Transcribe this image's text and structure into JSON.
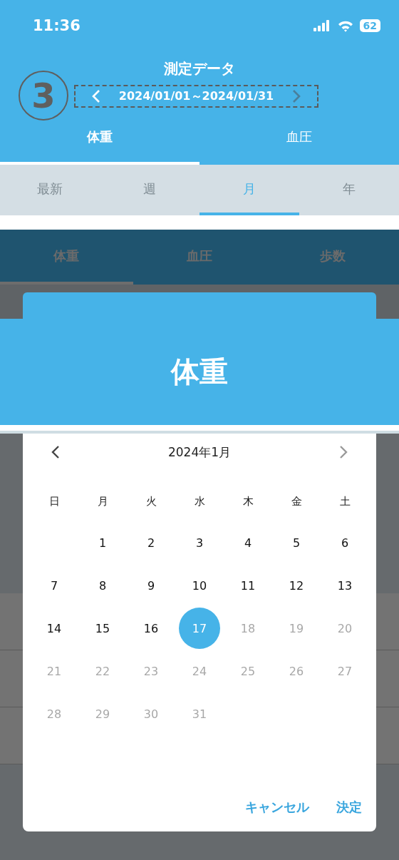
{
  "status_bar": {
    "time": "11:36",
    "battery": "62"
  },
  "header": {
    "title": "測定データ",
    "date_range": "2024/01/01～2024/01/31"
  },
  "annotation": {
    "step": "3"
  },
  "tabs": [
    {
      "label": "体重",
      "selected": true
    },
    {
      "label": "血圧",
      "selected": false
    }
  ],
  "period_tabs": [
    {
      "label": "最新",
      "selected": false
    },
    {
      "label": "週",
      "selected": false
    },
    {
      "label": "月",
      "selected": true
    },
    {
      "label": "年",
      "selected": false
    }
  ],
  "background_tabs": [
    {
      "label": "体重",
      "selected": true
    },
    {
      "label": "血圧",
      "selected": false
    },
    {
      "label": "歩数",
      "selected": false
    }
  ],
  "banner": {
    "title": "体重"
  },
  "date_picker": {
    "month_label": "2024年1月",
    "weekdays": [
      "日",
      "月",
      "火",
      "水",
      "木",
      "金",
      "土"
    ],
    "weeks": [
      [
        {
          "label": "1",
          "selected": false,
          "disabled": false
        },
        {
          "label": "2",
          "selected": false,
          "disabled": false
        },
        {
          "label": "3",
          "selected": false,
          "disabled": false
        },
        {
          "label": "4",
          "selected": false,
          "disabled": false
        },
        {
          "label": "5",
          "selected": false,
          "disabled": false
        },
        {
          "label": "6",
          "selected": false,
          "disabled": false
        }
      ],
      [
        {
          "label": "7",
          "selected": false,
          "disabled": false
        },
        {
          "label": "8",
          "selected": false,
          "disabled": false
        },
        {
          "label": "9",
          "selected": false,
          "disabled": false
        },
        {
          "label": "10",
          "selected": false,
          "disabled": false
        },
        {
          "label": "11",
          "selected": false,
          "disabled": false
        },
        {
          "label": "12",
          "selected": false,
          "disabled": false
        },
        {
          "label": "13",
          "selected": false,
          "disabled": false
        }
      ],
      [
        {
          "label": "14",
          "selected": false,
          "disabled": false
        },
        {
          "label": "15",
          "selected": false,
          "disabled": false
        },
        {
          "label": "16",
          "selected": false,
          "disabled": false
        },
        {
          "label": "17",
          "selected": true,
          "disabled": false
        },
        {
          "label": "18",
          "selected": false,
          "disabled": true
        },
        {
          "label": "19",
          "selected": false,
          "disabled": true
        },
        {
          "label": "20",
          "selected": false,
          "disabled": true
        }
      ],
      [
        {
          "label": "21",
          "selected": false,
          "disabled": true
        },
        {
          "label": "22",
          "selected": false,
          "disabled": true
        },
        {
          "label": "23",
          "selected": false,
          "disabled": true
        },
        {
          "label": "24",
          "selected": false,
          "disabled": true
        },
        {
          "label": "25",
          "selected": false,
          "disabled": true
        },
        {
          "label": "26",
          "selected": false,
          "disabled": true
        },
        {
          "label": "27",
          "selected": false,
          "disabled": true
        }
      ],
      [
        {
          "label": "28",
          "selected": false,
          "disabled": true
        },
        {
          "label": "29",
          "selected": false,
          "disabled": true
        },
        {
          "label": "30",
          "selected": false,
          "disabled": true
        },
        {
          "label": "31",
          "selected": false,
          "disabled": true
        }
      ]
    ],
    "buttons": [
      {
        "label": "キャンセル"
      },
      {
        "label": "決定"
      }
    ]
  }
}
